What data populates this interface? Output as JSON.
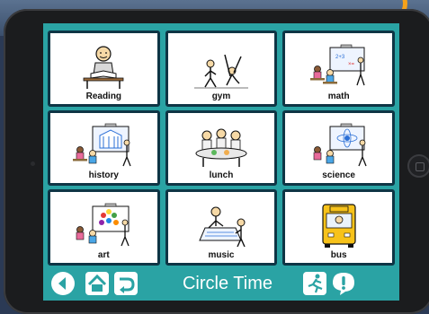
{
  "board": {
    "tiles": [
      {
        "label": "Reading",
        "icon": "reading-icon"
      },
      {
        "label": "gym",
        "icon": "gym-icon"
      },
      {
        "label": "math",
        "icon": "math-icon"
      },
      {
        "label": "history",
        "icon": "history-icon"
      },
      {
        "label": "lunch",
        "icon": "lunch-icon"
      },
      {
        "label": "science",
        "icon": "science-icon"
      },
      {
        "label": "art",
        "icon": "art-icon"
      },
      {
        "label": "music",
        "icon": "music-icon"
      },
      {
        "label": "bus",
        "icon": "bus-icon"
      }
    ]
  },
  "toolbar": {
    "title": "Circle Time",
    "back_icon": "back-arrow-icon",
    "home_icon": "home-icon",
    "undo_icon": "return-arrow-icon",
    "running_icon": "running-person-icon",
    "alert_icon": "exclamation-icon"
  },
  "colors": {
    "screen_background": "#2aa3a4",
    "tile_border": "#0e3545",
    "tile_background": "#ffffff",
    "bezel": "#1b1c1e",
    "accent_orange": "#f5a11a"
  }
}
